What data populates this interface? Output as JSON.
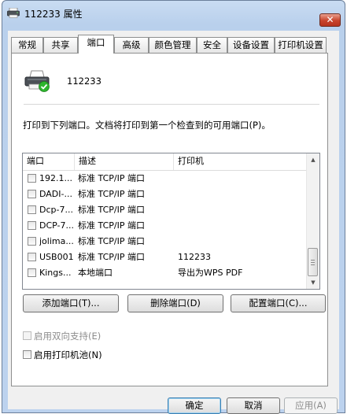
{
  "window": {
    "title": "112233 属性",
    "close_label": "✕"
  },
  "tabs": [
    {
      "label": "常规"
    },
    {
      "label": "共享"
    },
    {
      "label": "端口"
    },
    {
      "label": "高级"
    },
    {
      "label": "颜色管理"
    },
    {
      "label": "安全"
    },
    {
      "label": "设备设置"
    },
    {
      "label": "打印机设置"
    }
  ],
  "active_tab": "端口",
  "printer": {
    "name": "112233"
  },
  "instruction": "打印到下列端口。文档将打印到第一个检查到的可用端口(P)。",
  "port_list": {
    "headers": {
      "port": "端口",
      "description": "描述",
      "printer": "打印机"
    },
    "rows": [
      {
        "port": "192.1...",
        "description": "标准 TCP/IP 端口",
        "printer": ""
      },
      {
        "port": "DADI-...",
        "description": "标准 TCP/IP 端口",
        "printer": ""
      },
      {
        "port": "Dcp-7...",
        "description": "标准 TCP/IP 端口",
        "printer": ""
      },
      {
        "port": "DCP-7...",
        "description": "标准 TCP/IP 端口",
        "printer": ""
      },
      {
        "port": "jolima...",
        "description": "标准 TCP/IP 端口",
        "printer": ""
      },
      {
        "port": "USB001",
        "description": "标准 TCP/IP 端口",
        "printer": "112233"
      },
      {
        "port": "Kings...",
        "description": "本地端口",
        "printer": "导出为WPS PDF"
      }
    ]
  },
  "port_buttons": {
    "add": "添加端口(T)...",
    "delete": "删除端口(D)",
    "configure": "配置端口(C)..."
  },
  "options": {
    "bidirectional": "启用双向支持(E)",
    "pooling": "启用打印机池(N)"
  },
  "dialog_buttons": {
    "ok": "确定",
    "cancel": "取消",
    "apply": "应用(A)"
  },
  "colors": {
    "titlebar": "#bcd2ee",
    "close_button": "#c8432b",
    "panel_background": "#ffffff",
    "status_badge": "#2db52d"
  }
}
